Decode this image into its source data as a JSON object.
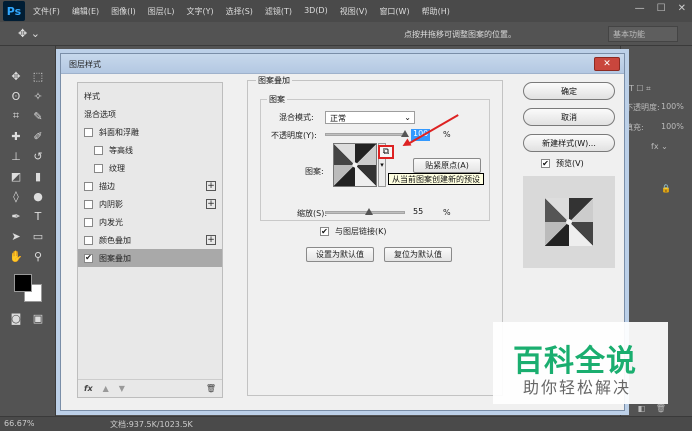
{
  "app": {
    "logo": "Ps"
  },
  "menu": [
    "文件(F)",
    "编辑(E)",
    "图像(I)",
    "图层(L)",
    "文字(Y)",
    "选择(S)",
    "滤镜(T)",
    "3D(D)",
    "视图(V)",
    "窗口(W)",
    "帮助(H)"
  ],
  "options_bar": {
    "hint": "点按并拖移可调整图案的位置。",
    "workspace": "基本功能"
  },
  "status": {
    "zoom": "66.67%",
    "doc": "文档:937.5K/1023.5K"
  },
  "right_panel": {
    "opacity_label": "不透明度:",
    "opacity_value": "100%",
    "fill_label": "填充:",
    "fill_value": "100%"
  },
  "dialog": {
    "title": "图层样式",
    "close": "✕",
    "style_list": [
      {
        "label": "样式",
        "check": false,
        "plus": false,
        "indent": 0,
        "selected": false
      },
      {
        "label": "混合选项",
        "check": false,
        "plus": false,
        "indent": 0,
        "selected": false
      },
      {
        "label": "斜面和浮雕",
        "check": true,
        "checked": false,
        "plus": false,
        "indent": 0,
        "selected": false
      },
      {
        "label": "等高线",
        "check": true,
        "checked": false,
        "plus": false,
        "indent": 1,
        "selected": false
      },
      {
        "label": "纹理",
        "check": true,
        "checked": false,
        "plus": false,
        "indent": 1,
        "selected": false
      },
      {
        "label": "描边",
        "check": true,
        "checked": false,
        "plus": true,
        "indent": 0,
        "selected": false
      },
      {
        "label": "内阴影",
        "check": true,
        "checked": false,
        "plus": true,
        "indent": 0,
        "selected": false
      },
      {
        "label": "内发光",
        "check": true,
        "checked": false,
        "plus": false,
        "indent": 0,
        "selected": false
      },
      {
        "label": "颜色叠加",
        "check": true,
        "checked": false,
        "plus": true,
        "indent": 0,
        "selected": false
      },
      {
        "label": "图案叠加",
        "check": true,
        "checked": true,
        "plus": false,
        "indent": 0,
        "selected": true
      }
    ],
    "list_footer": {
      "fx": "fx",
      "up": "▲",
      "down": "▼",
      "trash": "🗑"
    },
    "section_title": "图案叠加",
    "group_title": "图案",
    "blend_mode_label": "混合模式:",
    "blend_mode_value": "正常",
    "opacity_label": "不透明度(Y):",
    "opacity_value": "100",
    "opacity_unit": "%",
    "opacity_level": 1.0,
    "pattern_label": "图案:",
    "snap_origin": "贴紧原点(A)",
    "tooltip": "从当前图案创建新的预设",
    "scale_label": "缩放(S):",
    "scale_value": "55",
    "scale_unit": "%",
    "scale_level": 0.55,
    "link_label": "与图层链接(K)",
    "link_checked": true,
    "set_default": "设置为默认值",
    "reset_default": "复位为默认值",
    "ok": "确定",
    "cancel": "取消",
    "new_style": "新建样式(W)...",
    "preview_label": "预览(V)",
    "preview_checked": true
  },
  "watermark": {
    "title": "百科全说",
    "subtitle": "助你轻松解决"
  },
  "colors": {
    "accent": "#31a8ff",
    "annotation": "#dd2222",
    "watermark": "#1aae6f"
  }
}
